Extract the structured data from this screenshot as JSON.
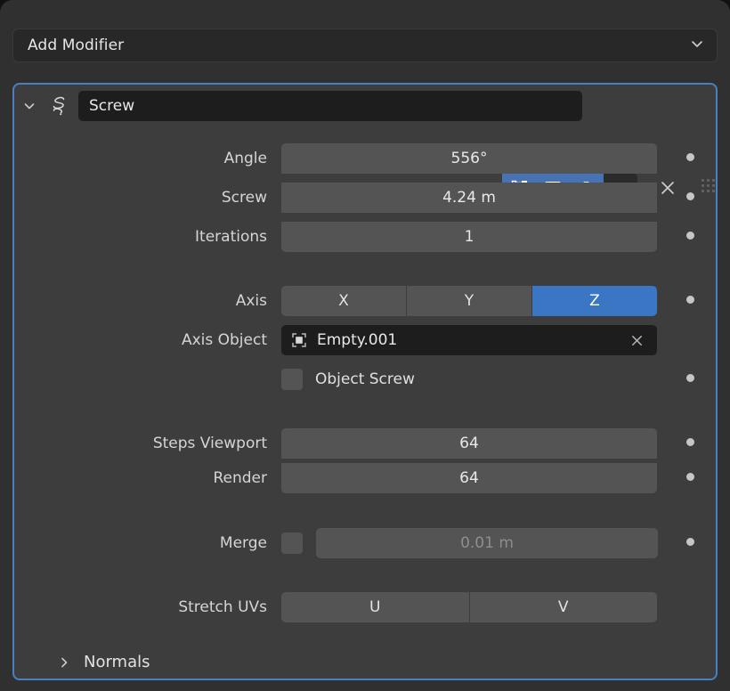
{
  "window": {
    "background_color": "#303030",
    "page_background": "#111111"
  },
  "add_modifier": {
    "label": "Add Modifier",
    "dropdown_icon": "chevron-down-icon"
  },
  "modifier_panel": {
    "name": "Screw",
    "type_icon": "screw-modifier-icon",
    "expanded": true,
    "border_color": "#4a7fc1",
    "header": {
      "expand_icon": "chevron-down-icon",
      "toggles": [
        {
          "name": "edit-mode-display-toggle",
          "icon": "edit-mode-icon",
          "active": true
        },
        {
          "name": "realtime-viewport-display-toggle",
          "icon": "monitor-icon",
          "active": true
        },
        {
          "name": "render-display-toggle",
          "icon": "camera-icon",
          "active": true
        }
      ],
      "extras_icon": "chevron-down-icon",
      "close_icon": "close-x-icon",
      "grip_icon": "drag-grip-icon"
    },
    "properties": [
      {
        "label": "Angle",
        "value": "556°"
      },
      {
        "label": "Screw",
        "value": "4.24 m"
      },
      {
        "label": "Iterations",
        "value": "1"
      }
    ],
    "axis": {
      "label": "Axis",
      "options": [
        "X",
        "Y",
        "Z"
      ],
      "selected": "Z",
      "active_color": "#3a76c4"
    },
    "axis_object": {
      "label": "Axis Object",
      "value": "Empty.001",
      "object_icon": "empty-object-icon",
      "clear_icon": "close-x-icon"
    },
    "object_screw": {
      "label": "Object Screw",
      "checked": false
    },
    "steps": [
      {
        "label": "Steps Viewport",
        "value": "64"
      },
      {
        "label": "Render",
        "value": "64"
      }
    ],
    "merge": {
      "label": "Merge",
      "checked": false,
      "value": "0.01 m",
      "enabled": false
    },
    "stretch_uvs": {
      "label": "Stretch UVs",
      "options": [
        "U",
        "V"
      ]
    },
    "subpanels": [
      {
        "label": "Normals",
        "expanded": false,
        "icon": "chevron-right-icon"
      }
    ]
  }
}
